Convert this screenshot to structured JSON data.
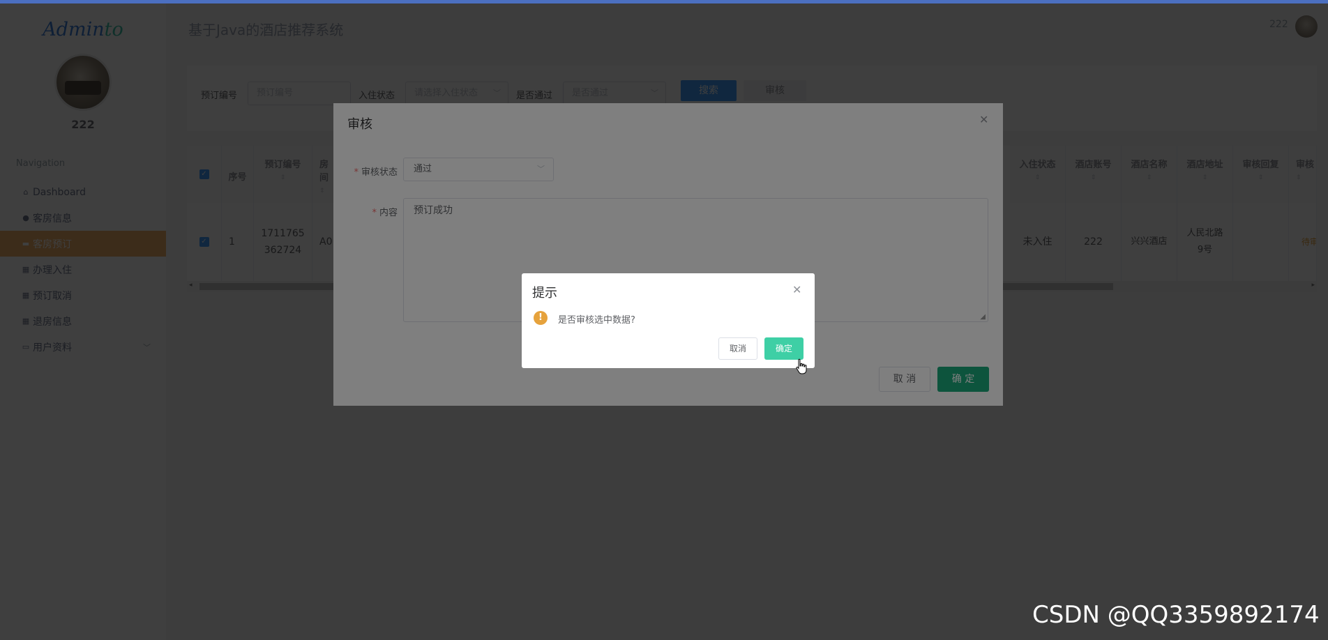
{
  "sidebar": {
    "logo_main": "Admin",
    "logo_tail": "to",
    "username": "222",
    "nav_title": "Navigation",
    "items": [
      {
        "label": "Dashboard",
        "icon": "home-icon"
      },
      {
        "label": "客房信息",
        "icon": "user-icon"
      },
      {
        "label": "客房预订",
        "icon": "room-icon",
        "active": true
      },
      {
        "label": "办理入住",
        "icon": "grid-icon"
      },
      {
        "label": "预订取消",
        "icon": "grid-icon"
      },
      {
        "label": "退房信息",
        "icon": "grid-icon"
      },
      {
        "label": "用户资料",
        "icon": "profile-icon",
        "has_submenu": true
      }
    ]
  },
  "header": {
    "title": "基于Java的酒店推荐系统",
    "user": "222"
  },
  "search": {
    "booking_no_label": "预订编号",
    "booking_no_placeholder": "预订编号",
    "checkin_label": "入住状态",
    "checkin_placeholder": "请选择入住状态",
    "passed_label": "是否通过",
    "passed_placeholder": "是否通过",
    "search_btn": "搜索",
    "audit_btn": "审核"
  },
  "table": {
    "headers": [
      "序号",
      "预订编号",
      "房间",
      "入住状态",
      "酒店账号",
      "酒店名称",
      "酒店地址",
      "审核回复",
      "审核"
    ],
    "row": {
      "index": "1",
      "booking_no_line1": "1711765",
      "booking_no_line2": "362724",
      "room": "A0",
      "checkin_status": "未入住",
      "hotel_account": "222",
      "hotel_name": "兴兴酒店",
      "hotel_address_line1": "人民北路",
      "hotel_address_line2": "9号",
      "audit_reply": "",
      "audit": "待审"
    }
  },
  "audit_dialog": {
    "title": "审核",
    "status_label": "审核状态",
    "status_value": "通过",
    "content_label": "内容",
    "content_value": "预订成功",
    "cancel": "取 消",
    "confirm": "确 定"
  },
  "confirm_box": {
    "title": "提示",
    "message": "是否审核选中数据?",
    "cancel": "取消",
    "confirm": "确定"
  },
  "watermark": "CSDN @QQ3359892174",
  "colors": {
    "primary": "#409eff",
    "active_menu": "#f2b06a",
    "dialog_ok": "#1aa97b",
    "msgbox_ok": "#3ecfa5",
    "warning": "#e6a23c"
  }
}
